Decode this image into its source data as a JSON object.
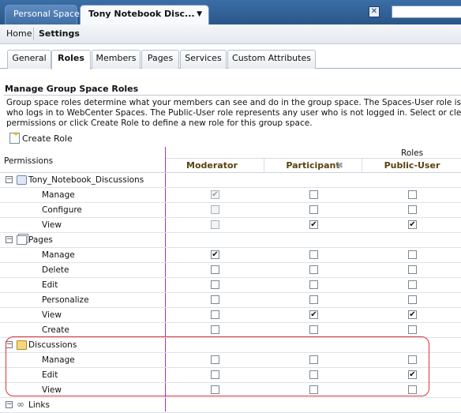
{
  "top_tabs": {
    "personal_space": "Personal Space",
    "active_space": "Tony Notebook Disc..."
  },
  "nav": {
    "home": "Home",
    "settings": "Settings"
  },
  "sub_tabs": [
    "General",
    "Roles",
    "Members",
    "Pages",
    "Services",
    "Custom Attributes"
  ],
  "section": {
    "title": "Manage Group Space Roles",
    "desc_line1": "Group space roles determine what your members can see and do in the group space. The Spaces-User role is the defaul",
    "desc_line2": "who logs in to WebCenter Spaces. The Public-User role represents any user who is not logged in. Select or clear the che",
    "desc_line3": "permissions or click Create Role to define a new role for this group space.",
    "create_role": "Create Role"
  },
  "grid": {
    "roles_caption": "Roles",
    "permissions_caption": "Permissions",
    "columns": [
      "Moderator",
      "Participant",
      "Public-User"
    ],
    "groups": [
      {
        "label": "Tony_Notebook_Discussions",
        "icon": "users-icon",
        "rows": [
          {
            "label": "Manage",
            "values": [
              true,
              false,
              false
            ],
            "disabled": [
              true,
              false,
              false
            ]
          },
          {
            "label": "Configure",
            "values": [
              false,
              false,
              false
            ],
            "disabled": [
              true,
              false,
              false
            ]
          },
          {
            "label": "View",
            "values": [
              false,
              true,
              true
            ],
            "disabled": [
              true,
              false,
              false
            ]
          }
        ]
      },
      {
        "label": "Pages",
        "icon": "pages-icon",
        "rows": [
          {
            "label": "Manage",
            "values": [
              true,
              false,
              false
            ]
          },
          {
            "label": "Delete",
            "values": [
              false,
              false,
              false
            ]
          },
          {
            "label": "Edit",
            "values": [
              false,
              false,
              false
            ]
          },
          {
            "label": "Personalize",
            "values": [
              false,
              false,
              false
            ]
          },
          {
            "label": "View",
            "values": [
              false,
              true,
              true
            ]
          },
          {
            "label": "Create",
            "values": [
              false,
              false,
              false
            ]
          }
        ]
      },
      {
        "label": "Discussions",
        "icon": "folder-icon",
        "rows": [
          {
            "label": "Manage",
            "values": [
              false,
              false,
              false
            ]
          },
          {
            "label": "Edit",
            "values": [
              false,
              false,
              true
            ]
          },
          {
            "label": "View",
            "values": [
              false,
              false,
              false
            ]
          }
        ]
      },
      {
        "label": "Links",
        "icon": "link-icon",
        "rows": []
      }
    ]
  },
  "colors": {
    "accent": "#2a5689",
    "highlight_box": "#e0303a",
    "column_divider": "#9a37c4"
  }
}
